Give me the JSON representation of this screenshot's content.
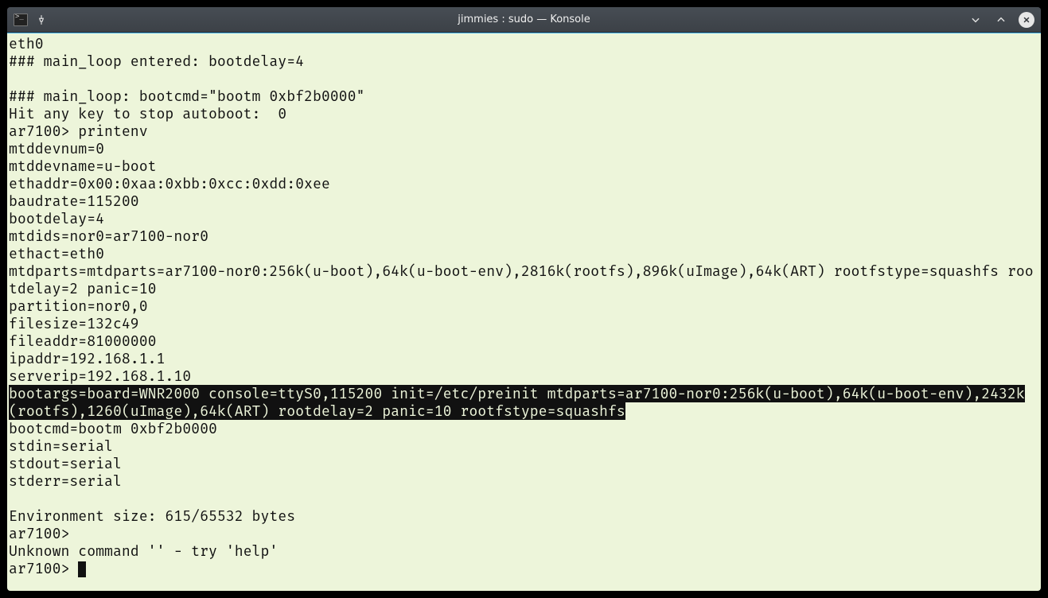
{
  "window": {
    "title": "jimmies : sudo — Konsole"
  },
  "terminal": {
    "lines": [
      {
        "text": "eth0"
      },
      {
        "text": "### main_loop entered: bootdelay=4"
      },
      {
        "text": ""
      },
      {
        "text": "### main_loop: bootcmd=\"bootm 0xbf2b0000\""
      },
      {
        "text": "Hit any key to stop autoboot:  0"
      },
      {
        "text": "ar7100> printenv"
      },
      {
        "text": "mtddevnum=0"
      },
      {
        "text": "mtddevname=u-boot"
      },
      {
        "text": "ethaddr=0x00:0xaa:0xbb:0xcc:0xdd:0xee"
      },
      {
        "text": "baudrate=115200"
      },
      {
        "text": "bootdelay=4"
      },
      {
        "text": "mtdids=nor0=ar7100-nor0"
      },
      {
        "text": "ethact=eth0"
      },
      {
        "text": "mtdparts=mtdparts=ar7100-nor0:256k(u-boot),64k(u-boot-env),2816k(rootfs),896k(uImage),64k(ART) rootfstype=squashfs rootdelay=2 panic=10"
      },
      {
        "text": "partition=nor0,0"
      },
      {
        "text": "filesize=132c49"
      },
      {
        "text": "fileaddr=81000000"
      },
      {
        "text": "ipaddr=192.168.1.1"
      },
      {
        "text": "serverip=192.168.1.10"
      },
      {
        "text": "bootargs=board=WNR2000 console=ttyS0,115200 init=/etc/preinit mtdparts=ar7100-nor0:256k(u-boot),64k(u-boot-env),2432k(rootfs),1260(uImage),64k(ART) rootdelay=2 panic=10 rootfstype=squashfs",
        "highlight": true
      },
      {
        "text": "bootcmd=bootm 0xbf2b0000"
      },
      {
        "text": "stdin=serial"
      },
      {
        "text": "stdout=serial"
      },
      {
        "text": "stderr=serial"
      },
      {
        "text": ""
      },
      {
        "text": "Environment size: 615/65532 bytes"
      },
      {
        "text": "ar7100>"
      },
      {
        "text": "Unknown command '' - try 'help'"
      },
      {
        "text": "ar7100> ",
        "cursor": true
      }
    ]
  }
}
